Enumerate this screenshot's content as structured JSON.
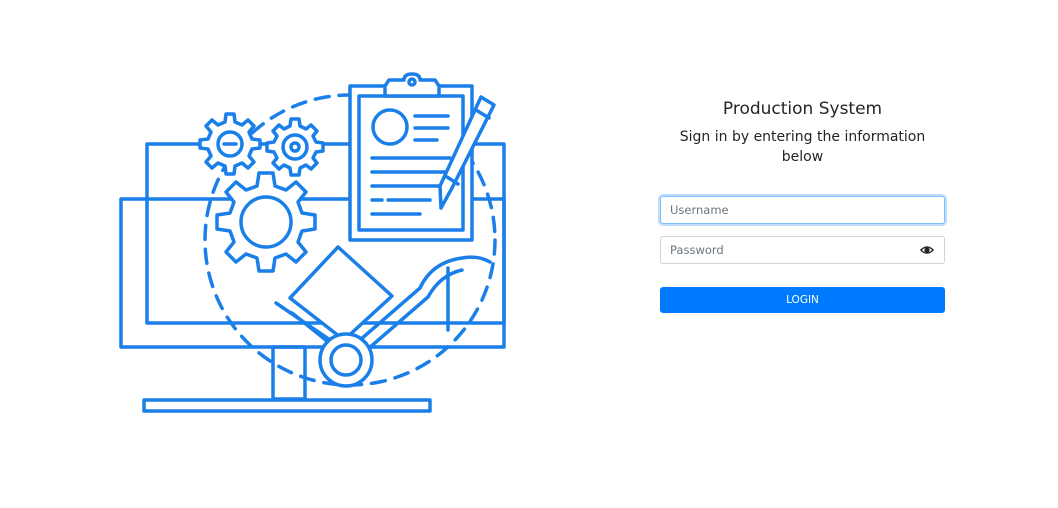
{
  "colors": {
    "accent": "#007bff",
    "illustration_stroke": "#1a7fe8",
    "text": "#212529",
    "border": "#ced4da"
  },
  "login": {
    "title": "Production System",
    "subtitle": "Sign in by entering the information below",
    "username": {
      "placeholder": "Username",
      "value": ""
    },
    "password": {
      "placeholder": "Password",
      "value": "",
      "toggle_icon": "eye-icon"
    },
    "submit_label": "LOGIN"
  },
  "illustration": {
    "icon": "production-system-illustration"
  }
}
